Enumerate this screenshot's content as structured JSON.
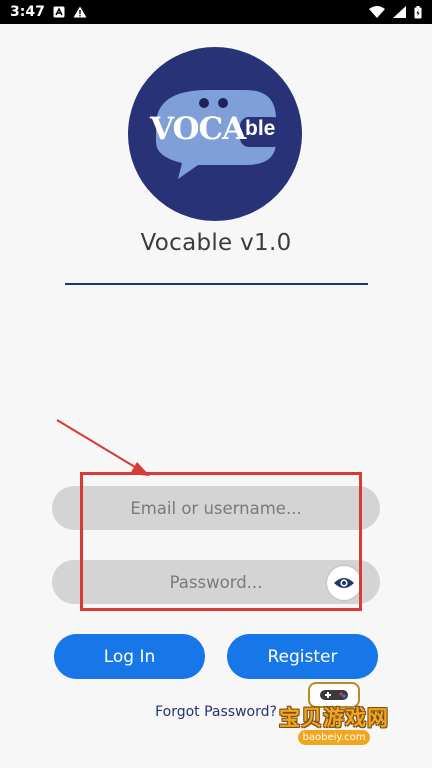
{
  "status_bar": {
    "time": "3:47",
    "left_icons": [
      "notification-a-icon",
      "warning-icon"
    ],
    "right_icons": [
      "wifi-icon",
      "signal-icon",
      "battery-icon"
    ]
  },
  "logo": {
    "text_main": "VOCA",
    "text_badge": "ble",
    "colors": {
      "circle": "#283276",
      "bubble": "#7f9fd8",
      "text": "#ffffff"
    }
  },
  "app": {
    "title": "Vocable v1.0"
  },
  "login_form": {
    "email_placeholder": "Email or username...",
    "password_placeholder": "Password...",
    "toggle_icon": "eye-icon"
  },
  "buttons": {
    "login": "Log In",
    "register": "Register"
  },
  "forgot_password": "Forgot Password?",
  "watermark": {
    "main": "宝贝游戏网",
    "sub": "baobeiy.com"
  },
  "colors": {
    "primary": "#1877e8",
    "navy": "#23356d",
    "highlight": "#d83a36",
    "field_bg": "#d4d4d4"
  }
}
